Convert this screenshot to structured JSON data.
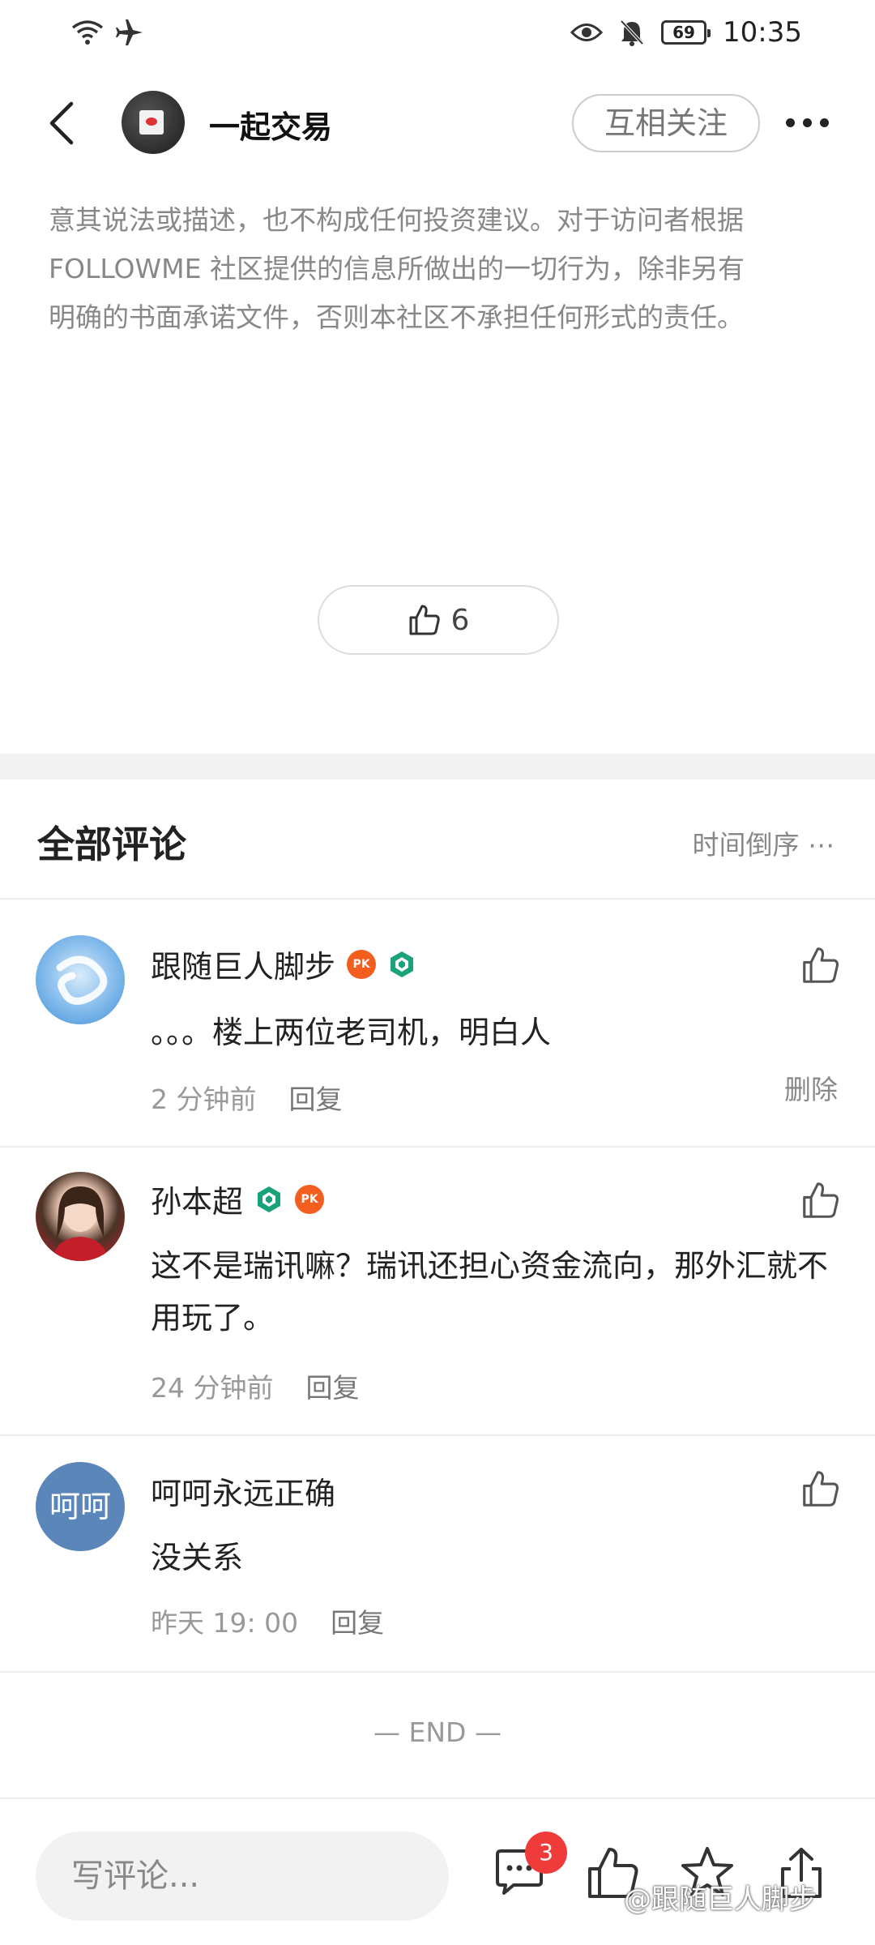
{
  "status_bar": {
    "time": "10:35",
    "battery": "69",
    "icons": [
      "wifi-icon",
      "airplane-icon",
      "eye-icon",
      "bell-off-icon",
      "battery-icon"
    ]
  },
  "nav": {
    "title": "一起交易",
    "follow_label": "互相关注"
  },
  "disclaimer": {
    "lines": [
      "意其说法或描述，也不构成任何投资建议。对于访问者根据",
      "FOLLOWME 社区提供的信息所做出的一切行为，除非另有",
      "明确的书面承诺文件，否则本社区不承担任何形式的责任。"
    ]
  },
  "post_like_count": "6",
  "comments_header": {
    "title": "全部评论",
    "sort_label": "时间倒序 ⋯"
  },
  "comments": [
    {
      "name": "跟随巨人脚步",
      "text": "。。。楼上两位老司机，明白人",
      "time": "2 分钟前",
      "reply": "回复",
      "delete": "删除",
      "badges": [
        "pk-badge",
        "verified-badge"
      ]
    },
    {
      "name": "孙本超",
      "text": "这不是瑞讯嘛？瑞讯还担心资金流向，那外汇就不用玩了。",
      "time": "24 分钟前",
      "reply": "回复",
      "badges": [
        "verified-badge",
        "pk-badge"
      ]
    },
    {
      "name": "呵呵永远正确",
      "avatar_text": "呵呵",
      "text": "没关系",
      "time": "昨天 19: 00",
      "reply": "回复"
    }
  ],
  "end_label": "— END —",
  "bottom_bar": {
    "placeholder": "写评论...",
    "comment_badge": "3",
    "watermark": "@跟随巨人脚步"
  },
  "colors": {
    "accent_red": "#f03b3b",
    "pk_orange": "#f35d1e",
    "verified_green": "#1aa37a",
    "avatar_blue": "#5b86b9"
  }
}
